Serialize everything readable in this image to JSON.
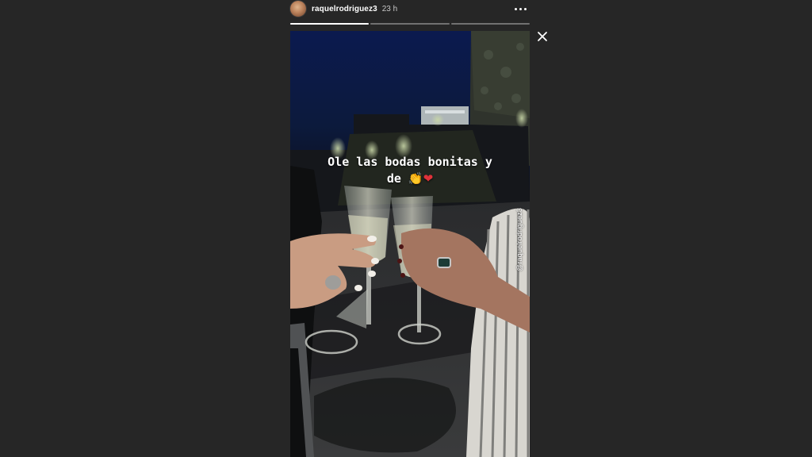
{
  "header": {
    "username": "raquelrodriguez3",
    "timestamp": "23 h",
    "more_icon": "more-horizontal-icon"
  },
  "progress": {
    "segments": 3,
    "current": 1,
    "fraction_of_current": 1.0
  },
  "close_icon": "close-icon",
  "story": {
    "caption_line1": "Ole las bodas bonitas y",
    "caption_line2": "de",
    "caption_emoji": "👏",
    "heart": "❤",
    "mention": "@raquelrodriguez3"
  },
  "colors": {
    "background": "#262626",
    "progress_active": "#ffffff",
    "heart": "#e0323a"
  }
}
